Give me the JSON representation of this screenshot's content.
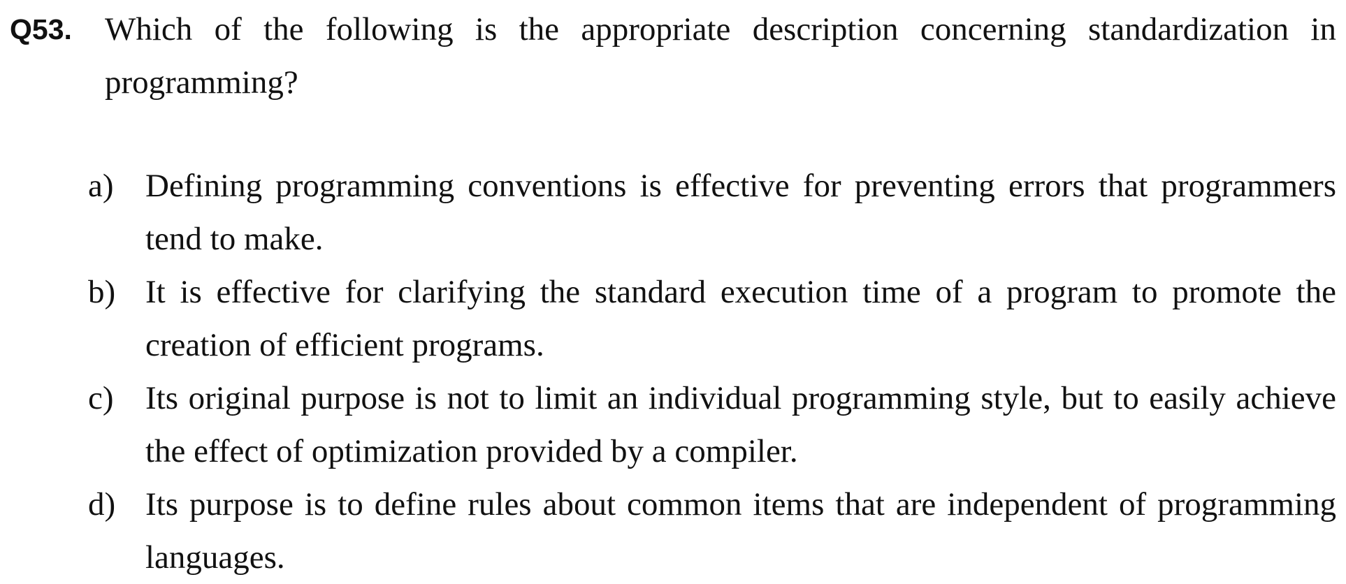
{
  "question": {
    "number": "Q53.",
    "text": "Which of the following is the appropriate description concerning standardization in programming?"
  },
  "options": [
    {
      "letter": "a)",
      "text": "Defining programming conventions is effective for preventing errors that programmers tend to make."
    },
    {
      "letter": "b)",
      "text": "It is effective for clarifying the standard execution time of a program to promote the creation of efficient programs."
    },
    {
      "letter": "c)",
      "text": "Its original purpose is not to limit an individual programming style, but to easily achieve the effect of optimization provided by a compiler."
    },
    {
      "letter": "d)",
      "text": "Its purpose is to define rules about common items that are independent of programming languages."
    }
  ]
}
